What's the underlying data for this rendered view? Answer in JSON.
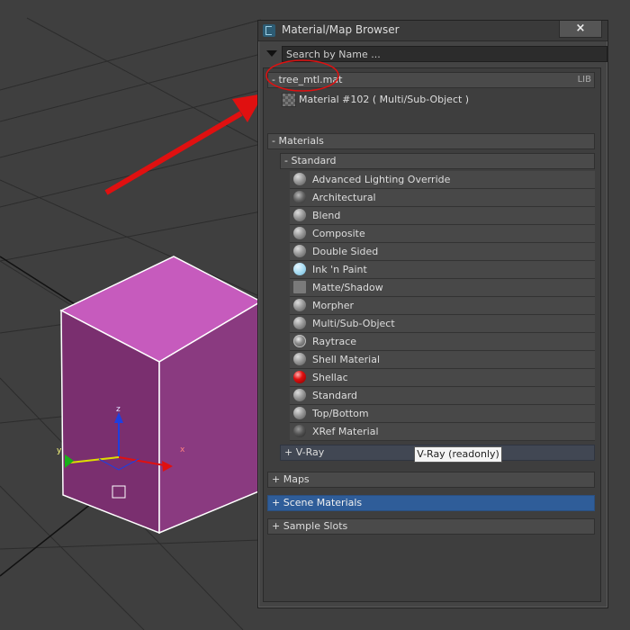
{
  "window": {
    "title": "Material/Map Browser",
    "close_label": "×"
  },
  "search": {
    "placeholder": "Search by Name ..."
  },
  "library": {
    "label": "- tree_mtl.mat",
    "tag": "LIB",
    "item": "Material #102  ( Multi/Sub-Object )"
  },
  "materials": {
    "header": "- Materials",
    "standard_header": "- Standard",
    "items": [
      {
        "label": "Advanced Lighting Override",
        "icon": "sphere-icon"
      },
      {
        "label": "Architectural",
        "icon": "architectural-sphere-icon"
      },
      {
        "label": "Blend",
        "icon": "sphere-icon"
      },
      {
        "label": "Composite",
        "icon": "sphere-icon"
      },
      {
        "label": "Double Sided",
        "icon": "sphere-icon"
      },
      {
        "label": "Ink 'n Paint",
        "icon": "ink-paint-sphere-icon"
      },
      {
        "label": "Matte/Shadow",
        "icon": "matte-swatch-icon"
      },
      {
        "label": "Morpher",
        "icon": "sphere-icon"
      },
      {
        "label": "Multi/Sub-Object",
        "icon": "sphere-icon"
      },
      {
        "label": "Raytrace",
        "icon": "raytrace-sphere-icon"
      },
      {
        "label": "Shell Material",
        "icon": "sphere-icon"
      },
      {
        "label": "Shellac",
        "icon": "shellac-red-sphere-icon"
      },
      {
        "label": "Standard",
        "icon": "sphere-icon"
      },
      {
        "label": "Top/Bottom",
        "icon": "sphere-icon"
      },
      {
        "label": "XRef Material",
        "icon": "xref-sphere-icon"
      }
    ],
    "vray_header": "+ V-Ray"
  },
  "maps_header": "+ Maps",
  "scene_materials_header": "+ Scene Materials",
  "sample_slots_header": "+ Sample Slots",
  "tooltip": "V-Ray (readonly)",
  "viewport": {
    "axis_labels": [
      "x",
      "y",
      "z"
    ],
    "cube_color": "#c65bbd"
  },
  "colors": {
    "selected_row": "#2f5d99",
    "annotation": "#e01010"
  }
}
